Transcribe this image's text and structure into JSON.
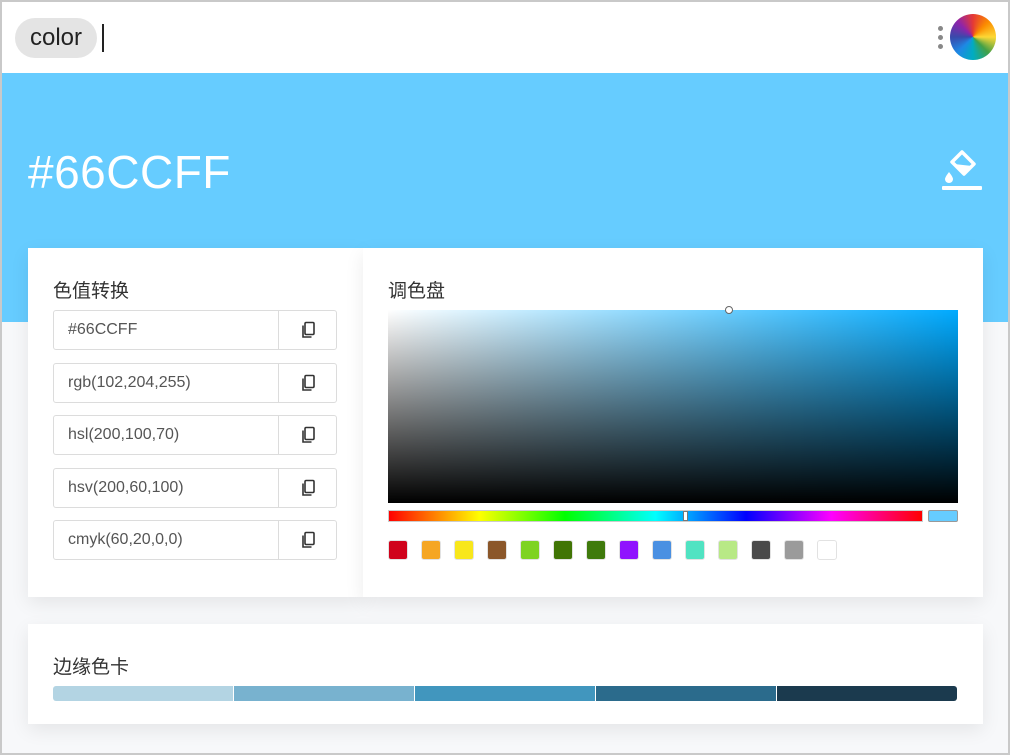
{
  "search": {
    "tag": "color"
  },
  "hero": {
    "hex": "#66CCFF",
    "background": "#66ccff"
  },
  "convert": {
    "title": "色值转换",
    "rows": [
      {
        "value": "#66CCFF"
      },
      {
        "value": "rgb(102,204,255)"
      },
      {
        "value": "hsl(200,100,70)"
      },
      {
        "value": "hsv(200,60,100)"
      },
      {
        "value": "cmyk(60,20,0,0)"
      }
    ],
    "copy_icon": "copy-icon"
  },
  "palette": {
    "title": "调色盘",
    "preview_color": "#66ccff",
    "swatches": [
      "#d0021b",
      "#f5a623",
      "#f8e71c",
      "#8b572a",
      "#7ed321",
      "#417505",
      "#3f7a0c",
      "#9013fe",
      "#4a90e2",
      "#50e3c2",
      "#b8e986",
      "#4a4a4a",
      "#9b9b9b",
      "#ffffff"
    ]
  },
  "edge": {
    "title": "边缘色卡",
    "colors": [
      "#b3d4e3",
      "#78b2cf",
      "#4196be",
      "#2b6b8c",
      "#1b3a4e"
    ]
  }
}
